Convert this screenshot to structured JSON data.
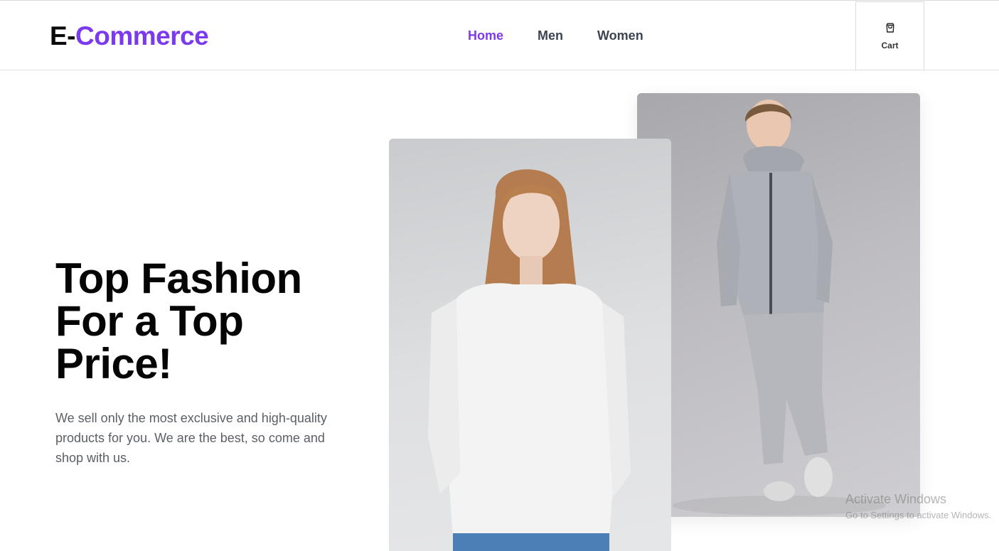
{
  "header": {
    "logo": {
      "prefix": "E-",
      "suffix": "Commerce"
    },
    "nav": [
      {
        "label": "Home",
        "active": true
      },
      {
        "label": "Men",
        "active": false
      },
      {
        "label": "Women",
        "active": false
      }
    ],
    "cart": {
      "label": "Cart",
      "icon": "shopping-bag-icon"
    }
  },
  "hero": {
    "title": "Top Fashion For a Top Price!",
    "description": "We sell only the most exclusive and high-quality products for you. We are the best, so come and shop with us."
  },
  "overlay": {
    "watermark_title": "Activate Windows",
    "watermark_sub": "Go to Settings to activate Windows."
  },
  "colors": {
    "accent": "#7c3aed",
    "text_dark": "#050505",
    "text_muted": "#5b5f66"
  }
}
